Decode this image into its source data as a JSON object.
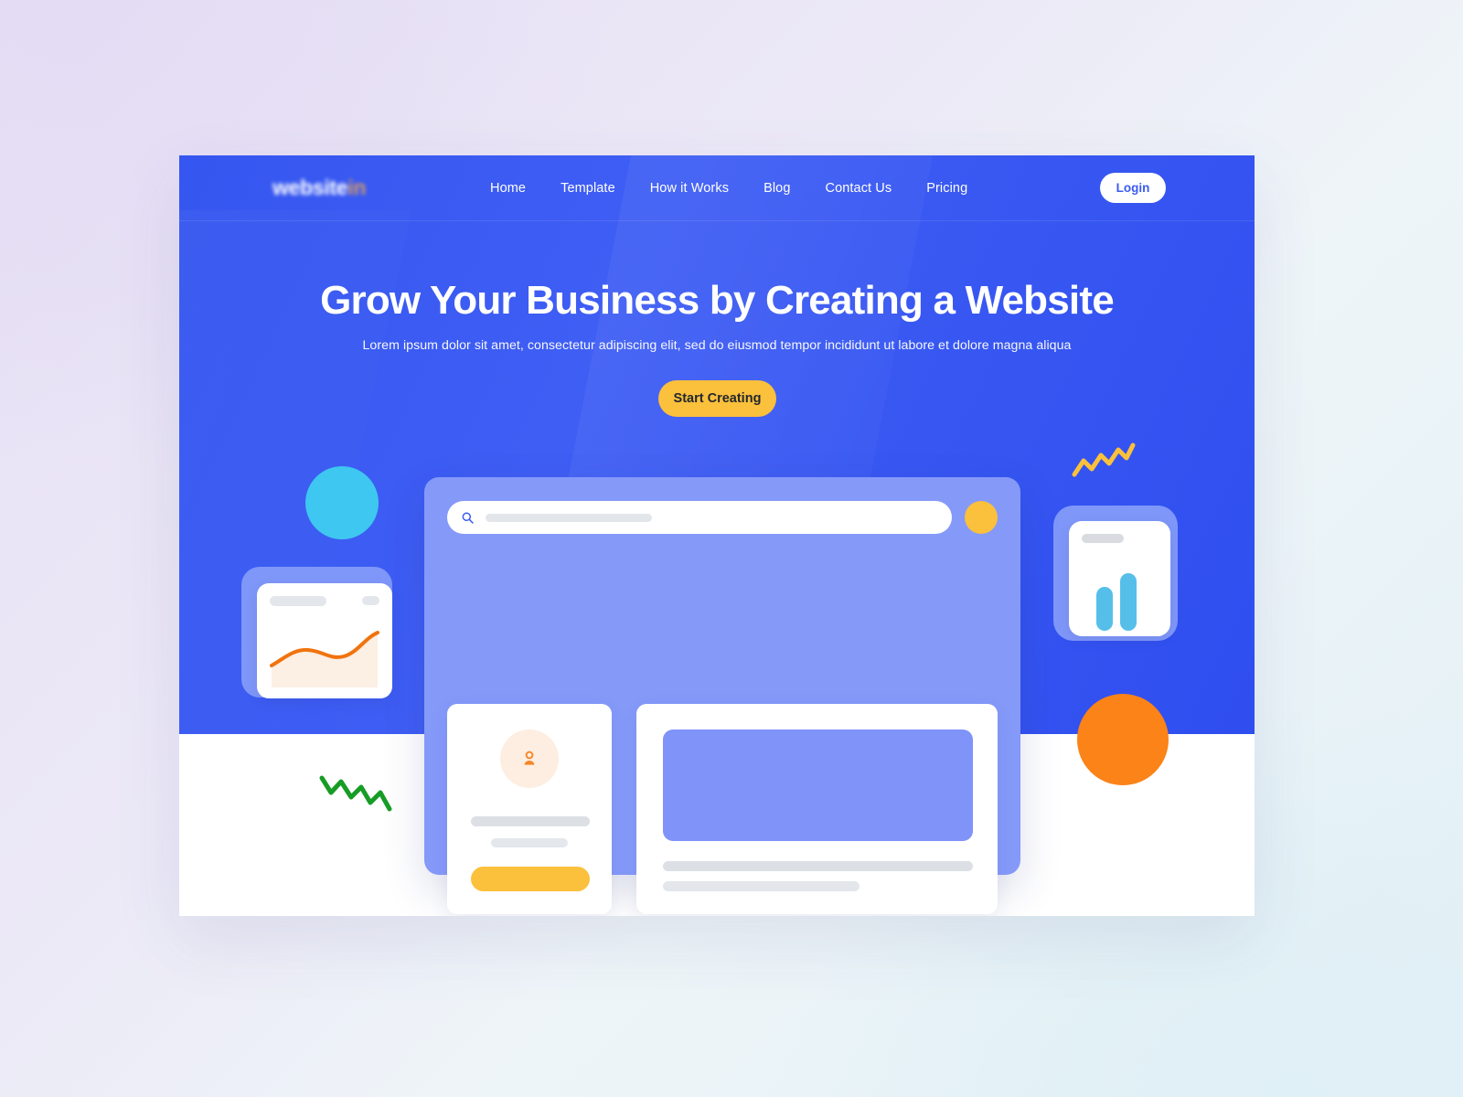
{
  "site": {
    "logo_text": "website",
    "logo_accent": "in"
  },
  "nav": {
    "items": [
      {
        "label": "Home"
      },
      {
        "label": "Template"
      },
      {
        "label": "How it Works"
      },
      {
        "label": "Blog"
      },
      {
        "label": "Contact Us"
      },
      {
        "label": "Pricing"
      }
    ],
    "login_label": "Login"
  },
  "hero": {
    "title": "Grow Your Business by Creating a Website",
    "subtitle": "Lorem ipsum dolor sit amet, consectetur adipiscing elit, sed do eiusmod tempor incididunt ut labore et dolore magna aliqua",
    "cta_label": "Start Creating"
  },
  "browser_mockup": {
    "search_icon": "search-icon",
    "search_placeholder": "",
    "accent_circle_color": "#fbc03c",
    "profile_card": {
      "avatar_icon": "user-icon",
      "button_label": ""
    },
    "mini_cards": [
      {
        "shape": "rounded-square",
        "color": "#b89ae6"
      },
      {
        "shape": "circle",
        "color": "#56bfe9"
      },
      {
        "shape": "triangle",
        "color": "#a8c8d4"
      }
    ]
  },
  "widgets": {
    "line_chart": {
      "icon": "line-chart-icon"
    },
    "bar_chart": {
      "icon": "bar-chart-icon"
    }
  },
  "decor": {
    "zigzag_yellow": "#fbc03c",
    "zigzag_green": "#179c25",
    "circle_cyan": "#3ec7f0",
    "circle_orange": "#fb8318"
  },
  "colors": {
    "brand_blue": "#3b5bf0",
    "accent_yellow": "#fbc03c",
    "accent_orange": "#fb8318",
    "panel_periwinkle": "#8599f9"
  }
}
